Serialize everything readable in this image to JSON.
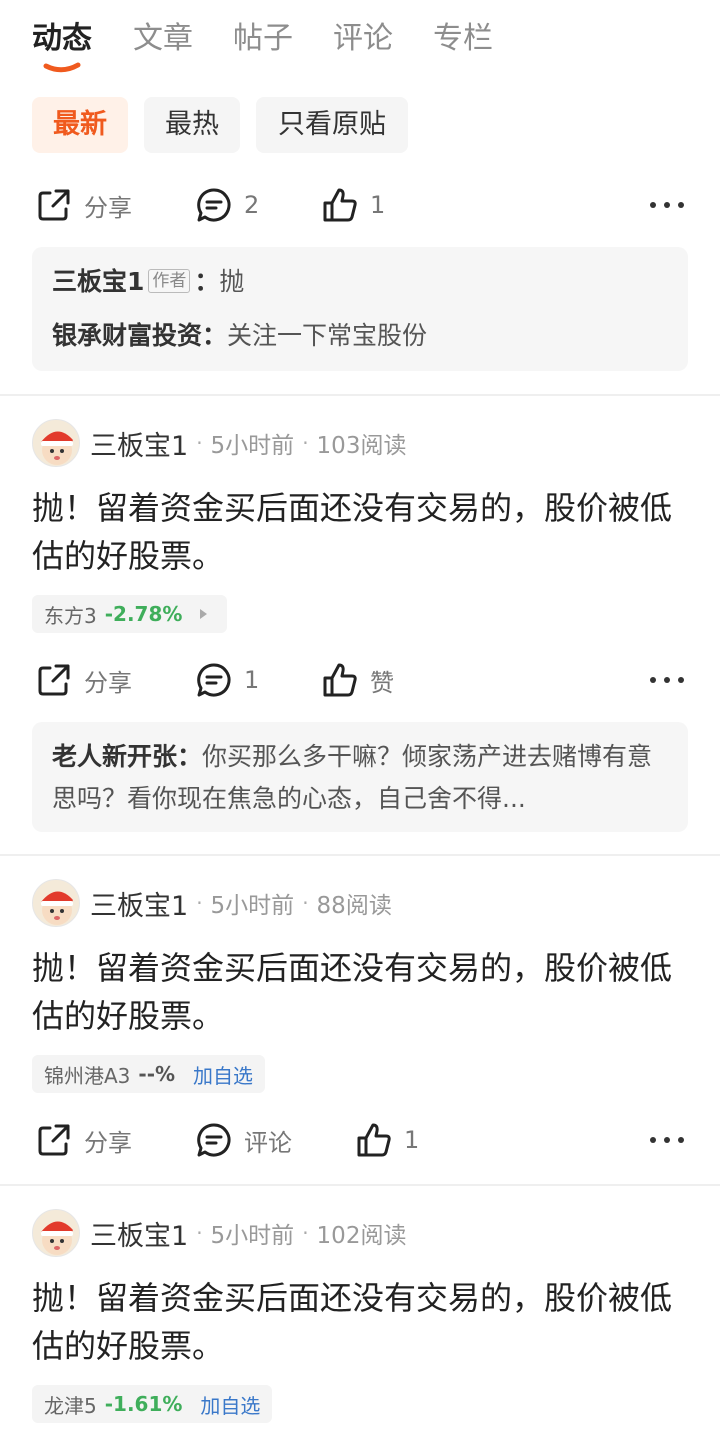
{
  "tabs": [
    {
      "label": "动态",
      "active": true
    },
    {
      "label": "文章",
      "active": false
    },
    {
      "label": "帖子",
      "active": false
    },
    {
      "label": "评论",
      "active": false
    },
    {
      "label": "专栏",
      "active": false
    }
  ],
  "filters": [
    {
      "label": "最新",
      "active": true
    },
    {
      "label": "最热",
      "active": false
    },
    {
      "label": "只看原贴",
      "active": false
    }
  ],
  "colors": {
    "accent": "#f05a1e",
    "down": "#3fae5b",
    "link": "#3a78c9"
  },
  "first_item": {
    "actions": {
      "share": "分享",
      "comment": "2",
      "like": "1"
    },
    "comments": [
      {
        "author": "三板宝1",
        "tag": "作者",
        "sep": "：",
        "text": "抛"
      },
      {
        "author": "银承财富投资",
        "sep": "：",
        "text": "关注一下常宝股份"
      }
    ]
  },
  "posts": [
    {
      "username": "三板宝1",
      "time": "5小时前",
      "reads": "103阅读",
      "text": "抛！留着资金买后面还没有交易的，股价被低估的好股票。",
      "stock": {
        "name": "东方3",
        "change": "-2.78%",
        "arrow_icon": "chevron-right-icon"
      },
      "actions": {
        "share": "分享",
        "comment": "1",
        "like": "赞"
      },
      "comment": {
        "author": "老人新开张",
        "sep": "：",
        "text": "你买那么多干嘛？倾家荡产进去赌博有意思吗？看你现在焦急的心态，自己舍不得..."
      }
    },
    {
      "username": "三板宝1",
      "time": "5小时前",
      "reads": "88阅读",
      "text": "抛！留着资金买后面还没有交易的，股价被低估的好股票。",
      "stock": {
        "name": "锦州港A3",
        "change": "--%",
        "add": "加自选"
      },
      "actions": {
        "share": "分享",
        "comment": "评论",
        "like": "1"
      }
    },
    {
      "username": "三板宝1",
      "time": "5小时前",
      "reads": "102阅读",
      "text": "抛！留着资金买后面还没有交易的，股价被低估的好股票。",
      "stock": {
        "name": "龙津5",
        "change": "-1.61%",
        "add": "加自选"
      }
    }
  ]
}
